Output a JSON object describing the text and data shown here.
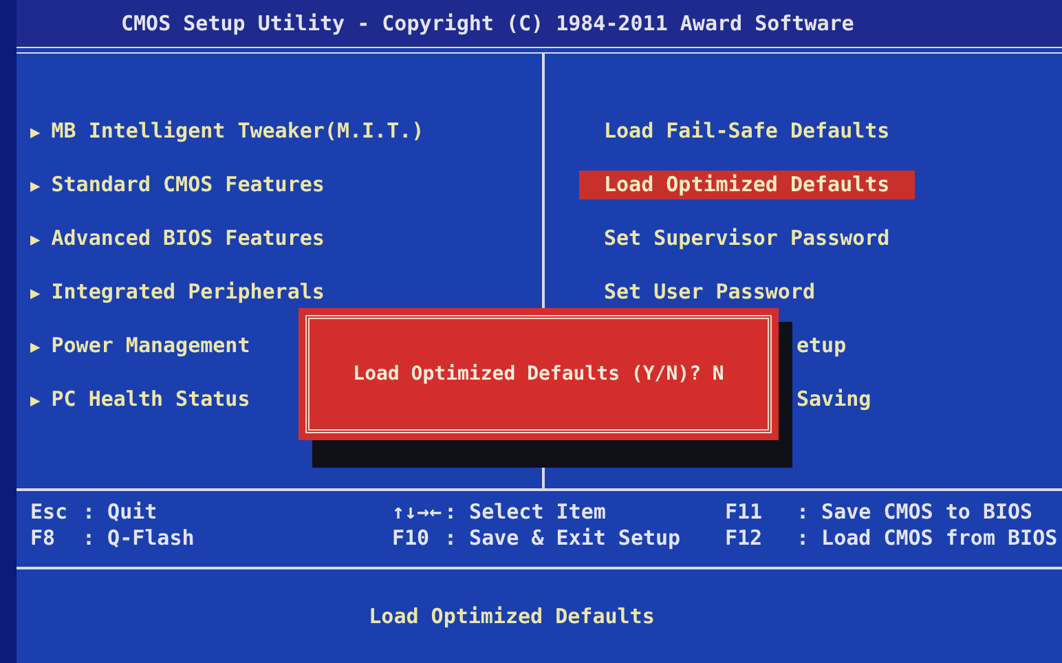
{
  "title": "CMOS Setup Utility - Copyright (C) 1984-2011 Award Software",
  "left_menu": [
    {
      "arrow": "▶",
      "label": "MB Intelligent Tweaker(M.I.T.)"
    },
    {
      "arrow": "▶",
      "label": "Standard CMOS Features"
    },
    {
      "arrow": "▶",
      "label": "Advanced BIOS Features"
    },
    {
      "arrow": "▶",
      "label": "Integrated Peripherals"
    },
    {
      "arrow": "▶",
      "label": "Power Management"
    },
    {
      "arrow": "▶",
      "label": "PC Health Status"
    }
  ],
  "right_menu": [
    {
      "label": "Load Fail-Safe Defaults",
      "selected": false,
      "covered": false
    },
    {
      "label": "Load Optimized Defaults",
      "selected": true,
      "covered": false
    },
    {
      "label": "Set Supervisor Password",
      "selected": false,
      "covered": false
    },
    {
      "label": "Set User Password",
      "selected": false,
      "covered": false
    },
    {
      "label": "etup",
      "selected": false,
      "covered": true
    },
    {
      "label": "Saving",
      "selected": false,
      "covered": true
    }
  ],
  "dialog": {
    "text": "Load Optimized Defaults (Y/N)? N"
  },
  "help": [
    [
      {
        "key": "Esc",
        "action": ": Quit"
      },
      {
        "key": "↑↓→←",
        "action": ": Select Item"
      },
      {
        "key": "F11",
        "action": ": Save CMOS to BIOS"
      }
    ],
    [
      {
        "key": "F8",
        "action": ": Q-Flash"
      },
      {
        "key": "F10",
        "action": ": Save & Exit Setup"
      },
      {
        "key": "F12",
        "action": ": Load CMOS from BIOS"
      }
    ]
  ],
  "status": "Load Optimized Defaults"
}
